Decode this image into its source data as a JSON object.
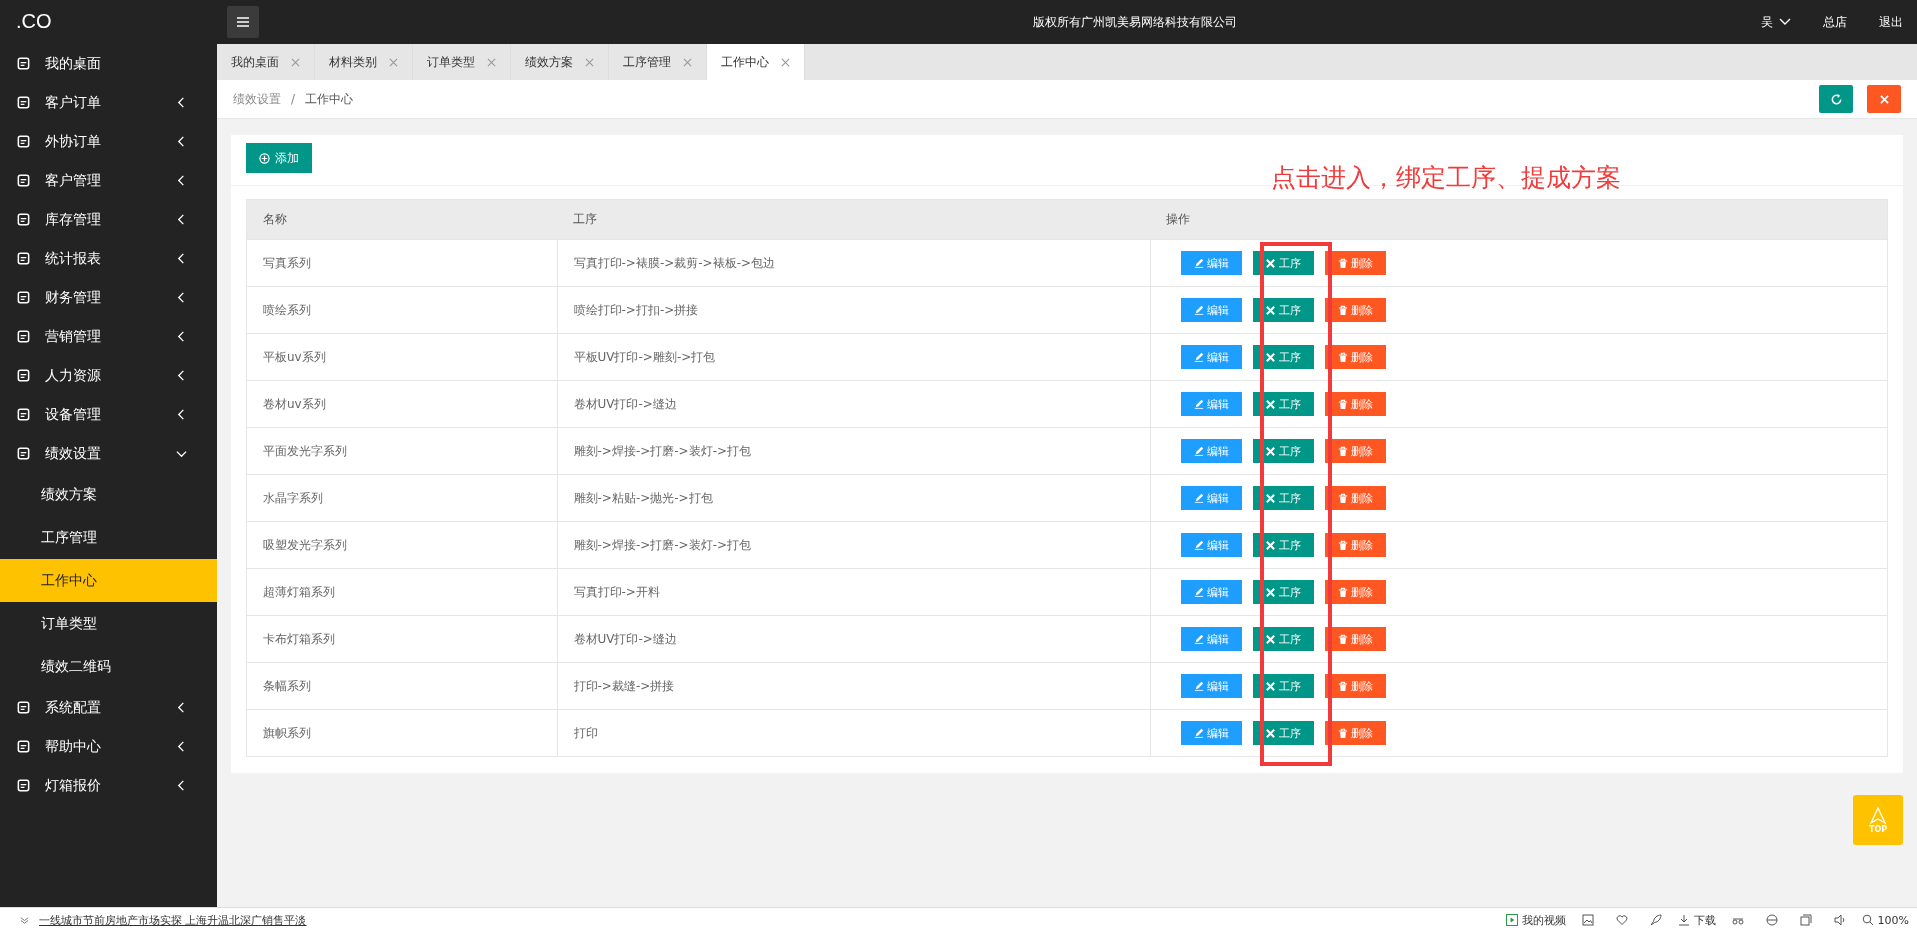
{
  "logo": ".CO",
  "header": {
    "title": "版权所有广州凯美易网络科技有限公司",
    "user": "吴",
    "store": "总店",
    "logout": "退出"
  },
  "sidebar": {
    "items": [
      {
        "label": "我的桌面"
      },
      {
        "label": "客户订单",
        "expanded": false
      },
      {
        "label": "外协订单",
        "expanded": false
      },
      {
        "label": "客户管理",
        "expanded": false
      },
      {
        "label": "库存管理",
        "expanded": false
      },
      {
        "label": "统计报表",
        "expanded": false
      },
      {
        "label": "财务管理",
        "expanded": false
      },
      {
        "label": "营销管理",
        "expanded": false
      },
      {
        "label": "人力资源",
        "expanded": false
      },
      {
        "label": "设备管理",
        "expanded": false
      },
      {
        "label": "绩效设置",
        "expanded": true,
        "children": [
          {
            "label": "绩效方案",
            "selected": false
          },
          {
            "label": "工序管理",
            "selected": false
          },
          {
            "label": "工作中心",
            "selected": true
          },
          {
            "label": "订单类型",
            "selected": false
          },
          {
            "label": "绩效二维码",
            "selected": false
          }
        ]
      },
      {
        "label": "系统配置",
        "expanded": false
      },
      {
        "label": "帮助中心",
        "expanded": false
      },
      {
        "label": "灯箱报价",
        "expanded": false
      }
    ]
  },
  "tabs": [
    {
      "label": "我的桌面",
      "selected": false
    },
    {
      "label": "材料类别",
      "selected": false
    },
    {
      "label": "订单类型",
      "selected": false
    },
    {
      "label": "绩效方案",
      "selected": false
    },
    {
      "label": "工序管理",
      "selected": false
    },
    {
      "label": "工作中心",
      "selected": true
    }
  ],
  "breadcrumb": [
    "绩效设置",
    "/",
    "工作中心"
  ],
  "add_button": "添加",
  "annotation": "点击进入，绑定工序、提成方案",
  "table": {
    "columns": [
      "名称",
      "工序",
      "操作"
    ],
    "rows": [
      {
        "name": "写真系列",
        "process": "写真打印->裱膜->裁剪->裱板->包边",
        "actions": [
          {
            "kind": "edit",
            "label": "编辑"
          },
          {
            "kind": "process",
            "label": "工序"
          },
          {
            "kind": "delete",
            "label": "删除"
          }
        ]
      },
      {
        "name": "喷绘系列",
        "process": "喷绘打印->打扣->拼接",
        "actions": [
          {
            "kind": "edit",
            "label": "编辑"
          },
          {
            "kind": "process",
            "label": "工序"
          },
          {
            "kind": "delete",
            "label": "删除"
          }
        ]
      },
      {
        "name": "平板uv系列",
        "process": "平板UV打印->雕刻->打包",
        "actions": [
          {
            "kind": "edit",
            "label": "编辑"
          },
          {
            "kind": "process",
            "label": "工序"
          },
          {
            "kind": "delete",
            "label": "删除"
          }
        ]
      },
      {
        "name": "卷材uv系列",
        "process": "卷材UV打印->缝边",
        "actions": [
          {
            "kind": "edit",
            "label": "编辑"
          },
          {
            "kind": "process",
            "label": "工序"
          },
          {
            "kind": "delete",
            "label": "删除"
          }
        ]
      },
      {
        "name": "平面发光字系列",
        "process": "雕刻->焊接->打磨->装灯->打包",
        "actions": [
          {
            "kind": "edit",
            "label": "编辑"
          },
          {
            "kind": "process",
            "label": "工序"
          },
          {
            "kind": "delete",
            "label": "删除"
          }
        ]
      },
      {
        "name": "水晶字系列",
        "process": "雕刻->粘贴->抛光->打包",
        "actions": [
          {
            "kind": "edit",
            "label": "编辑"
          },
          {
            "kind": "process",
            "label": "工序"
          },
          {
            "kind": "delete",
            "label": "删除"
          }
        ]
      },
      {
        "name": "吸塑发光字系列",
        "process": "雕刻->焊接->打磨->装灯->打包",
        "actions": [
          {
            "kind": "edit",
            "label": "编辑"
          },
          {
            "kind": "process",
            "label": "工序"
          },
          {
            "kind": "delete",
            "label": "删除"
          }
        ]
      },
      {
        "name": "超薄灯箱系列",
        "process": "写真打印->开料",
        "actions": [
          {
            "kind": "edit",
            "label": "编辑"
          },
          {
            "kind": "process",
            "label": "工序"
          },
          {
            "kind": "delete",
            "label": "删除"
          }
        ]
      },
      {
        "name": "卡布灯箱系列",
        "process": "卷材UV打印->缝边",
        "actions": [
          {
            "kind": "edit",
            "label": "编辑"
          },
          {
            "kind": "process",
            "label": "工序"
          },
          {
            "kind": "delete",
            "label": "删除"
          }
        ]
      },
      {
        "name": "条幅系列",
        "process": "打印->裁缝->拼接",
        "actions": [
          {
            "kind": "edit",
            "label": "编辑"
          },
          {
            "kind": "process",
            "label": "工序"
          },
          {
            "kind": "delete",
            "label": "删除"
          }
        ]
      },
      {
        "name": "旗帜系列",
        "process": "打印",
        "actions": [
          {
            "kind": "edit",
            "label": "编辑"
          },
          {
            "kind": "process",
            "label": "工序"
          },
          {
            "kind": "delete",
            "label": "删除"
          }
        ]
      }
    ]
  },
  "top_button": "TOP",
  "browser_bar": {
    "news": "一线城市节前房地产市场实探 上海升温北深广销售平淡",
    "video": "我的视频",
    "download": "下载",
    "zoom": "100%"
  }
}
